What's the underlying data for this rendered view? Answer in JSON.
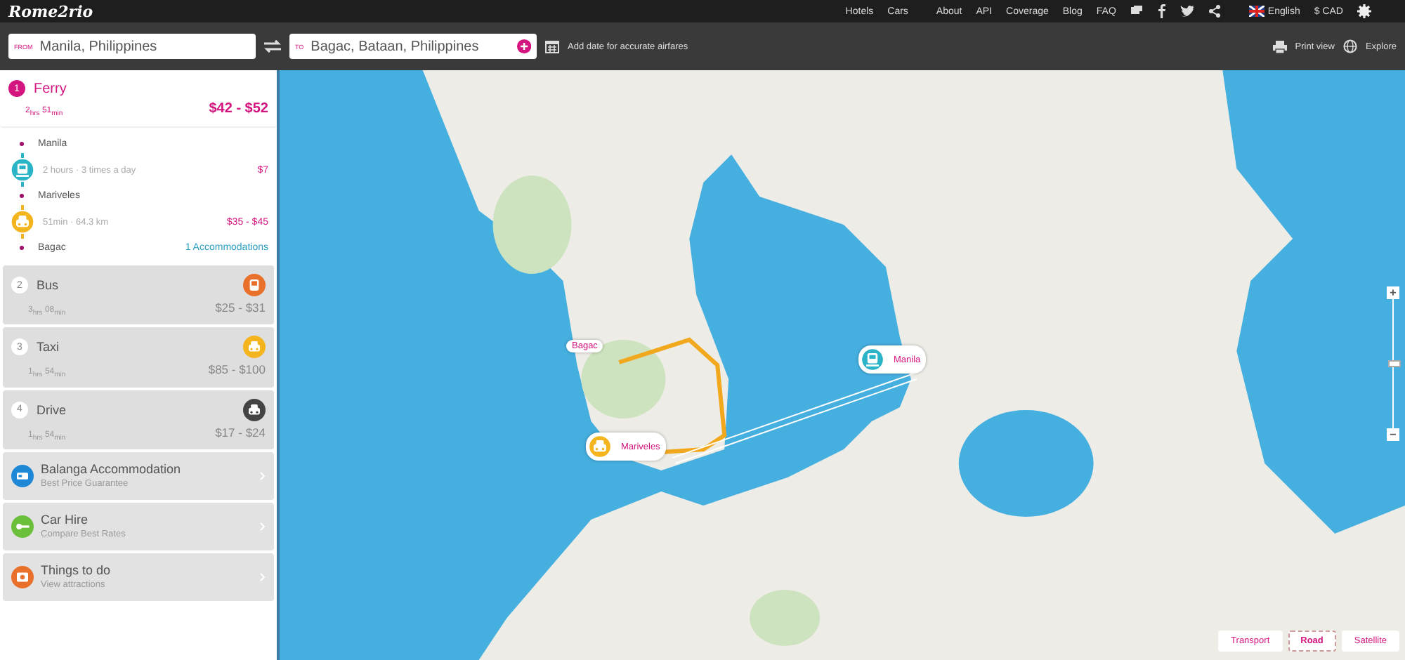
{
  "header": {
    "logo": "Rome2rio",
    "nav": [
      "Hotels",
      "Cars",
      "About",
      "API",
      "Coverage",
      "Blog",
      "FAQ"
    ],
    "language": "English",
    "currency": "$ CAD"
  },
  "search": {
    "from": {
      "label": "FROM",
      "value": "Manila, Philippines"
    },
    "to": {
      "label": "TO",
      "value": "Bagac, Bataan, Philippines"
    },
    "date_hint": "Add date for accurate airfares",
    "print": "Print view",
    "explore": "Explore"
  },
  "routes": [
    {
      "number": "1",
      "title": "Ferry",
      "duration": "2$_{hrs}$ 51$_{min}$",
      "price": "$42 - $52",
      "selected": true,
      "stops": [
        {
          "name": "Manila",
          "leg": {
            "kind": "ferry",
            "color": "#2bb3c7",
            "detail": "2 hours · 3 times a day",
            "price": "$7"
          }
        },
        {
          "name": "Mariveles",
          "leg": {
            "kind": "taxi",
            "color": "#f3b41e",
            "detail": "51min · 64.3 km",
            "price": "$35 - $45"
          }
        },
        {
          "name": "Bagac",
          "link": "1 Accommodations"
        }
      ]
    },
    {
      "number": "2",
      "title": "Bus",
      "duration": "3$_{hrs}$ 08$_{min}$",
      "price": "$25 - $31",
      "selected": false,
      "kind": "bus",
      "color": "#e8702a"
    },
    {
      "number": "3",
      "title": "Taxi",
      "duration": "1$_{hrs}$ 54$_{min}$",
      "price": "$85 - $100",
      "selected": false,
      "kind": "taxi",
      "color": "#f3b41e"
    },
    {
      "number": "4",
      "title": "Drive",
      "duration": "1$_{hrs}$ 54$_{min}$",
      "price": "$17 - $24",
      "selected": false,
      "kind": "car",
      "color": "#444444"
    }
  ],
  "extras": [
    {
      "title": "Balanga Accommodation",
      "subtitle": "Best Price Guarantee",
      "kind": "hotel",
      "color": "#1e88d6"
    },
    {
      "title": "Car Hire",
      "subtitle": "Compare Best Rates",
      "kind": "key",
      "color": "#6cbf3a"
    },
    {
      "title": "Things to do",
      "subtitle": "View attractions",
      "kind": "ticket",
      "color": "#e8702a"
    }
  ],
  "map": {
    "markers": [
      {
        "label": "Bagac",
        "kind": "none"
      },
      {
        "label": "Manila",
        "kind": "ferry",
        "color": "#2bb3c7"
      },
      {
        "label": "Mariveles",
        "kind": "taxi",
        "color": "#f3b41e"
      }
    ],
    "zoom": {
      "in": "+",
      "out": "−",
      "level": 0.5
    },
    "map_types": [
      {
        "label": "Transport",
        "selected": false
      },
      {
        "label": "Road",
        "selected": true
      },
      {
        "label": "Satellite",
        "selected": false
      }
    ]
  }
}
